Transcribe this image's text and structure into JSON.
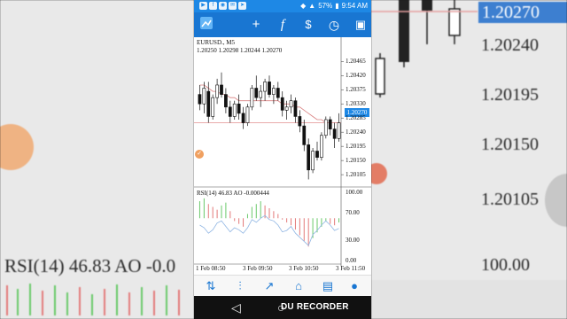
{
  "background": {
    "left_text": "RSI(14) 46.83 AO -0.0",
    "right_price_1": "1.20270",
    "right_price_2": "1.20240",
    "right_price_3": "1.20195",
    "right_price_4": "1.20150",
    "right_price_5": "1.20105",
    "right_rsi_100": "100.00"
  },
  "status_bar": {
    "battery": "57%",
    "time": "9:54 AM"
  },
  "toolbar": {
    "icons": [
      "menu-icon",
      "crosshair-icon",
      "function-icon",
      "trade-icon",
      "clock-icon",
      "add-order-icon"
    ]
  },
  "chart": {
    "symbol": "EURUSD., M5",
    "ohlc": "1.20250 1.20298 1.20244 1.20270",
    "indicator_label": "RSI(14) 46.83 AO -0.000444",
    "current_price": "1.20270",
    "colors": {
      "accent": "#1976d2",
      "price_line": "#e6a0a0",
      "ma_line": "#d98080",
      "rsi_line": "#8fb5e3",
      "ao_up": "#6ac96a",
      "ao_down": "#e37a7a"
    }
  },
  "chart_data": {
    "type": "line",
    "title": "EURUSD., M5",
    "price_axis": [
      "1.20465",
      "1.20420",
      "1.20375",
      "1.20330",
      "1.20285",
      "1.20240",
      "1.20195",
      "1.20150",
      "1.20105"
    ],
    "price_ylim": [
      1.2008,
      1.2048
    ],
    "indicator_axis": [
      "100.00",
      "70.00",
      "30.00",
      "0.00"
    ],
    "time_labels": [
      "1 Feb 08:50",
      "3 Feb 09:50",
      "3 Feb 10:50",
      "3 Feb 11:50"
    ],
    "last_price": 1.2027,
    "candles": [
      [
        1.2036,
        1.2039,
        1.2031,
        1.2033
      ],
      [
        1.2033,
        1.204,
        1.203,
        1.2038
      ],
      [
        1.2037,
        1.204,
        1.2027,
        1.2029
      ],
      [
        1.2029,
        1.2036,
        1.2028,
        1.2035
      ],
      [
        1.2035,
        1.2041,
        1.2033,
        1.2039
      ],
      [
        1.2039,
        1.2043,
        1.2035,
        1.2036
      ],
      [
        1.2036,
        1.2038,
        1.203,
        1.2032
      ],
      [
        1.2032,
        1.2034,
        1.2027,
        1.2029
      ],
      [
        1.2029,
        1.2034,
        1.2028,
        1.2033
      ],
      [
        1.2033,
        1.2036,
        1.2028,
        1.203
      ],
      [
        1.203,
        1.2032,
        1.2025,
        1.2027
      ],
      [
        1.2027,
        1.2033,
        1.2026,
        1.2032
      ],
      [
        1.2032,
        1.2039,
        1.2031,
        1.2038
      ],
      [
        1.2038,
        1.2042,
        1.2034,
        1.2035
      ],
      [
        1.2035,
        1.2039,
        1.2032,
        1.2037
      ],
      [
        1.2037,
        1.2041,
        1.2034,
        1.204
      ],
      [
        1.204,
        1.2042,
        1.2035,
        1.2036
      ],
      [
        1.2036,
        1.2039,
        1.2033,
        1.2038
      ],
      [
        1.2038,
        1.204,
        1.2034,
        1.2035
      ],
      [
        1.2035,
        1.2037,
        1.2029,
        1.2031
      ],
      [
        1.2031,
        1.2034,
        1.2028,
        1.2032
      ],
      [
        1.2032,
        1.2036,
        1.203,
        1.2034
      ],
      [
        1.2034,
        1.2035,
        1.2027,
        1.2029
      ],
      [
        1.2029,
        1.2031,
        1.2024,
        1.2026
      ],
      [
        1.2026,
        1.2028,
        1.2018,
        1.202
      ],
      [
        1.202,
        1.2022,
        1.2009,
        1.2012
      ],
      [
        1.2012,
        1.2019,
        1.2011,
        1.2018
      ],
      [
        1.2018,
        1.2021,
        1.2015,
        1.2016
      ],
      [
        1.2016,
        1.2024,
        1.2015,
        1.2023
      ],
      [
        1.2023,
        1.2029,
        1.2022,
        1.2028
      ],
      [
        1.2028,
        1.2029,
        1.2023,
        1.2025
      ],
      [
        1.2025,
        1.2027,
        1.2019,
        1.2022
      ],
      [
        1.2022,
        1.203,
        1.2021,
        1.2027
      ]
    ],
    "ma": [
      1.2039,
      1.2039,
      1.2038,
      1.2037,
      1.2037,
      1.2036,
      1.2036,
      1.2035,
      1.2035,
      1.2034,
      1.2034,
      1.2034,
      1.2034,
      1.2034,
      1.2034,
      1.2034,
      1.2034,
      1.2034,
      1.2034,
      1.2033,
      1.2033,
      1.2033,
      1.2032,
      1.2032,
      1.2031,
      1.203,
      1.2029,
      1.2028,
      1.2028,
      1.2027,
      1.2027,
      1.2027,
      1.2027
    ],
    "rsi": [
      52,
      48,
      40,
      45,
      55,
      58,
      50,
      42,
      48,
      45,
      40,
      48,
      60,
      56,
      62,
      66,
      60,
      58,
      52,
      42,
      44,
      50,
      40,
      34,
      28,
      22,
      38,
      44,
      52,
      58,
      52,
      44,
      47
    ],
    "ao": [
      12,
      14,
      10,
      8,
      6,
      9,
      11,
      5,
      -2,
      -4,
      -6,
      3,
      8,
      10,
      12,
      9,
      7,
      5,
      3,
      -1,
      -3,
      -5,
      -8,
      -12,
      -16,
      -20,
      -14,
      -10,
      -6,
      -2,
      -4,
      -5,
      -3
    ]
  },
  "bottom_bar": {
    "icons": [
      "quotes-icon",
      "chart-icon",
      "trade-icon",
      "history-icon",
      "news-icon",
      "chat-icon"
    ]
  },
  "nav_bar": {
    "recorder_label": "DU RECORDER"
  }
}
